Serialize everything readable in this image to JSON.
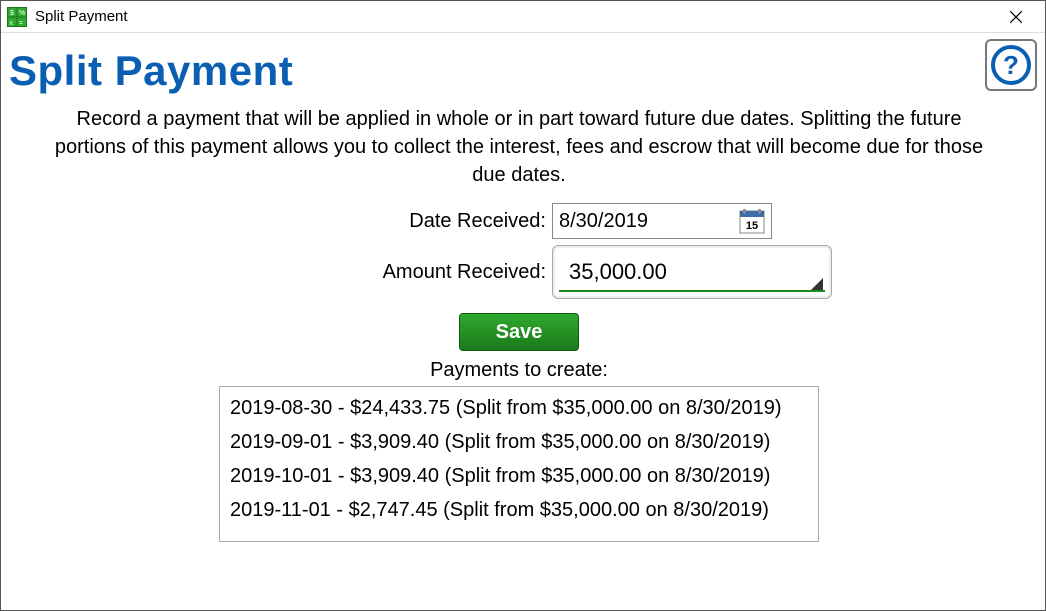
{
  "window": {
    "title": "Split Payment"
  },
  "page": {
    "heading": "Split Payment",
    "description": "Record a payment that will be applied in whole or in part toward future due dates. Splitting the future portions of this payment allows you to collect the interest, fees and escrow that will become due for those due dates."
  },
  "form": {
    "date_label": "Date Received:",
    "date_value": "8/30/2019",
    "amount_label": "Amount Received:",
    "amount_value": "35,000.00",
    "save_label": "Save"
  },
  "payments": {
    "label": "Payments to create:",
    "items": [
      "2019-08-30 - $24,433.75 (Split from $35,000.00 on 8/30/2019)",
      "2019-09-01 - $3,909.40 (Split from $35,000.00 on 8/30/2019)",
      "2019-10-01 - $3,909.40 (Split from $35,000.00 on 8/30/2019)",
      "2019-11-01 - $2,747.45 (Split from $35,000.00 on 8/30/2019)"
    ]
  },
  "calendar_day": "15"
}
